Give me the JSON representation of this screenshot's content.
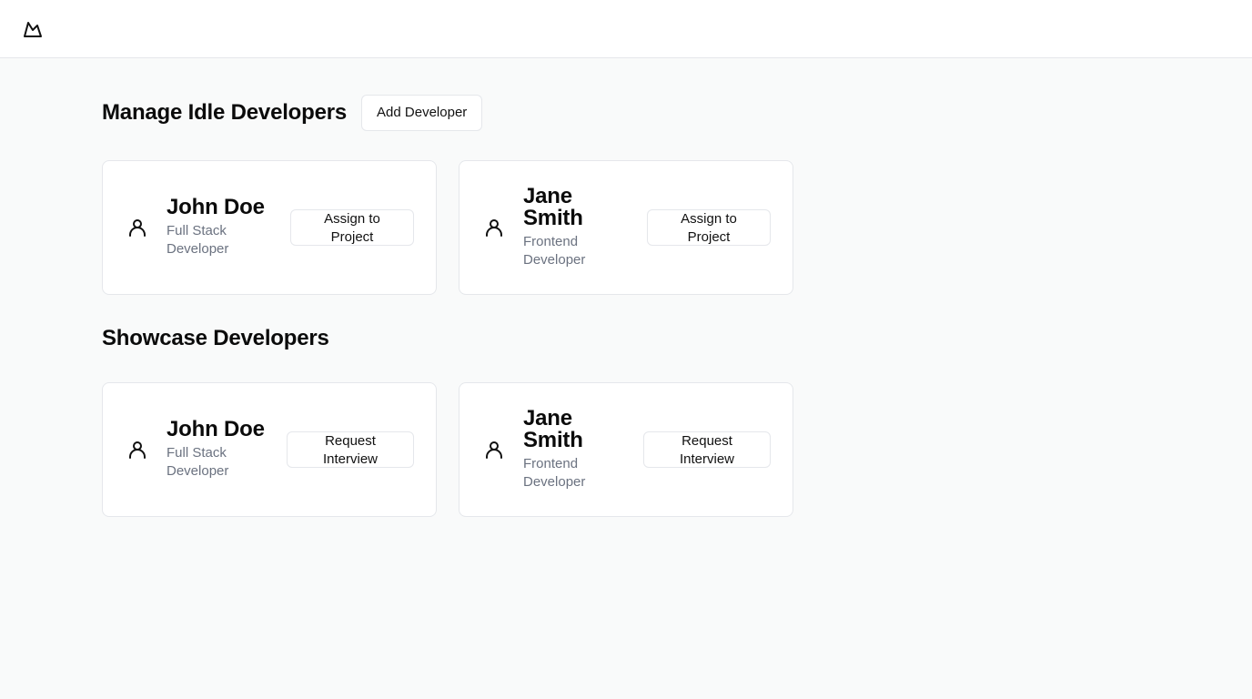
{
  "header": {
    "logo_icon": "mountain-logo-icon"
  },
  "idle": {
    "title": "Manage Idle Developers",
    "add_button": "Add Developer",
    "developers": [
      {
        "name": "John Doe",
        "role": "Full Stack Developer",
        "action": "Assign to Project"
      },
      {
        "name": "Jane Smith",
        "role": "Frontend Developer",
        "action": "Assign to Project"
      }
    ]
  },
  "showcase": {
    "title": "Showcase Developers",
    "developers": [
      {
        "name": "John Doe",
        "role": "Full Stack Developer",
        "action": "Request Interview"
      },
      {
        "name": "Jane Smith",
        "role": "Frontend Developer",
        "action": "Request Interview"
      }
    ]
  }
}
